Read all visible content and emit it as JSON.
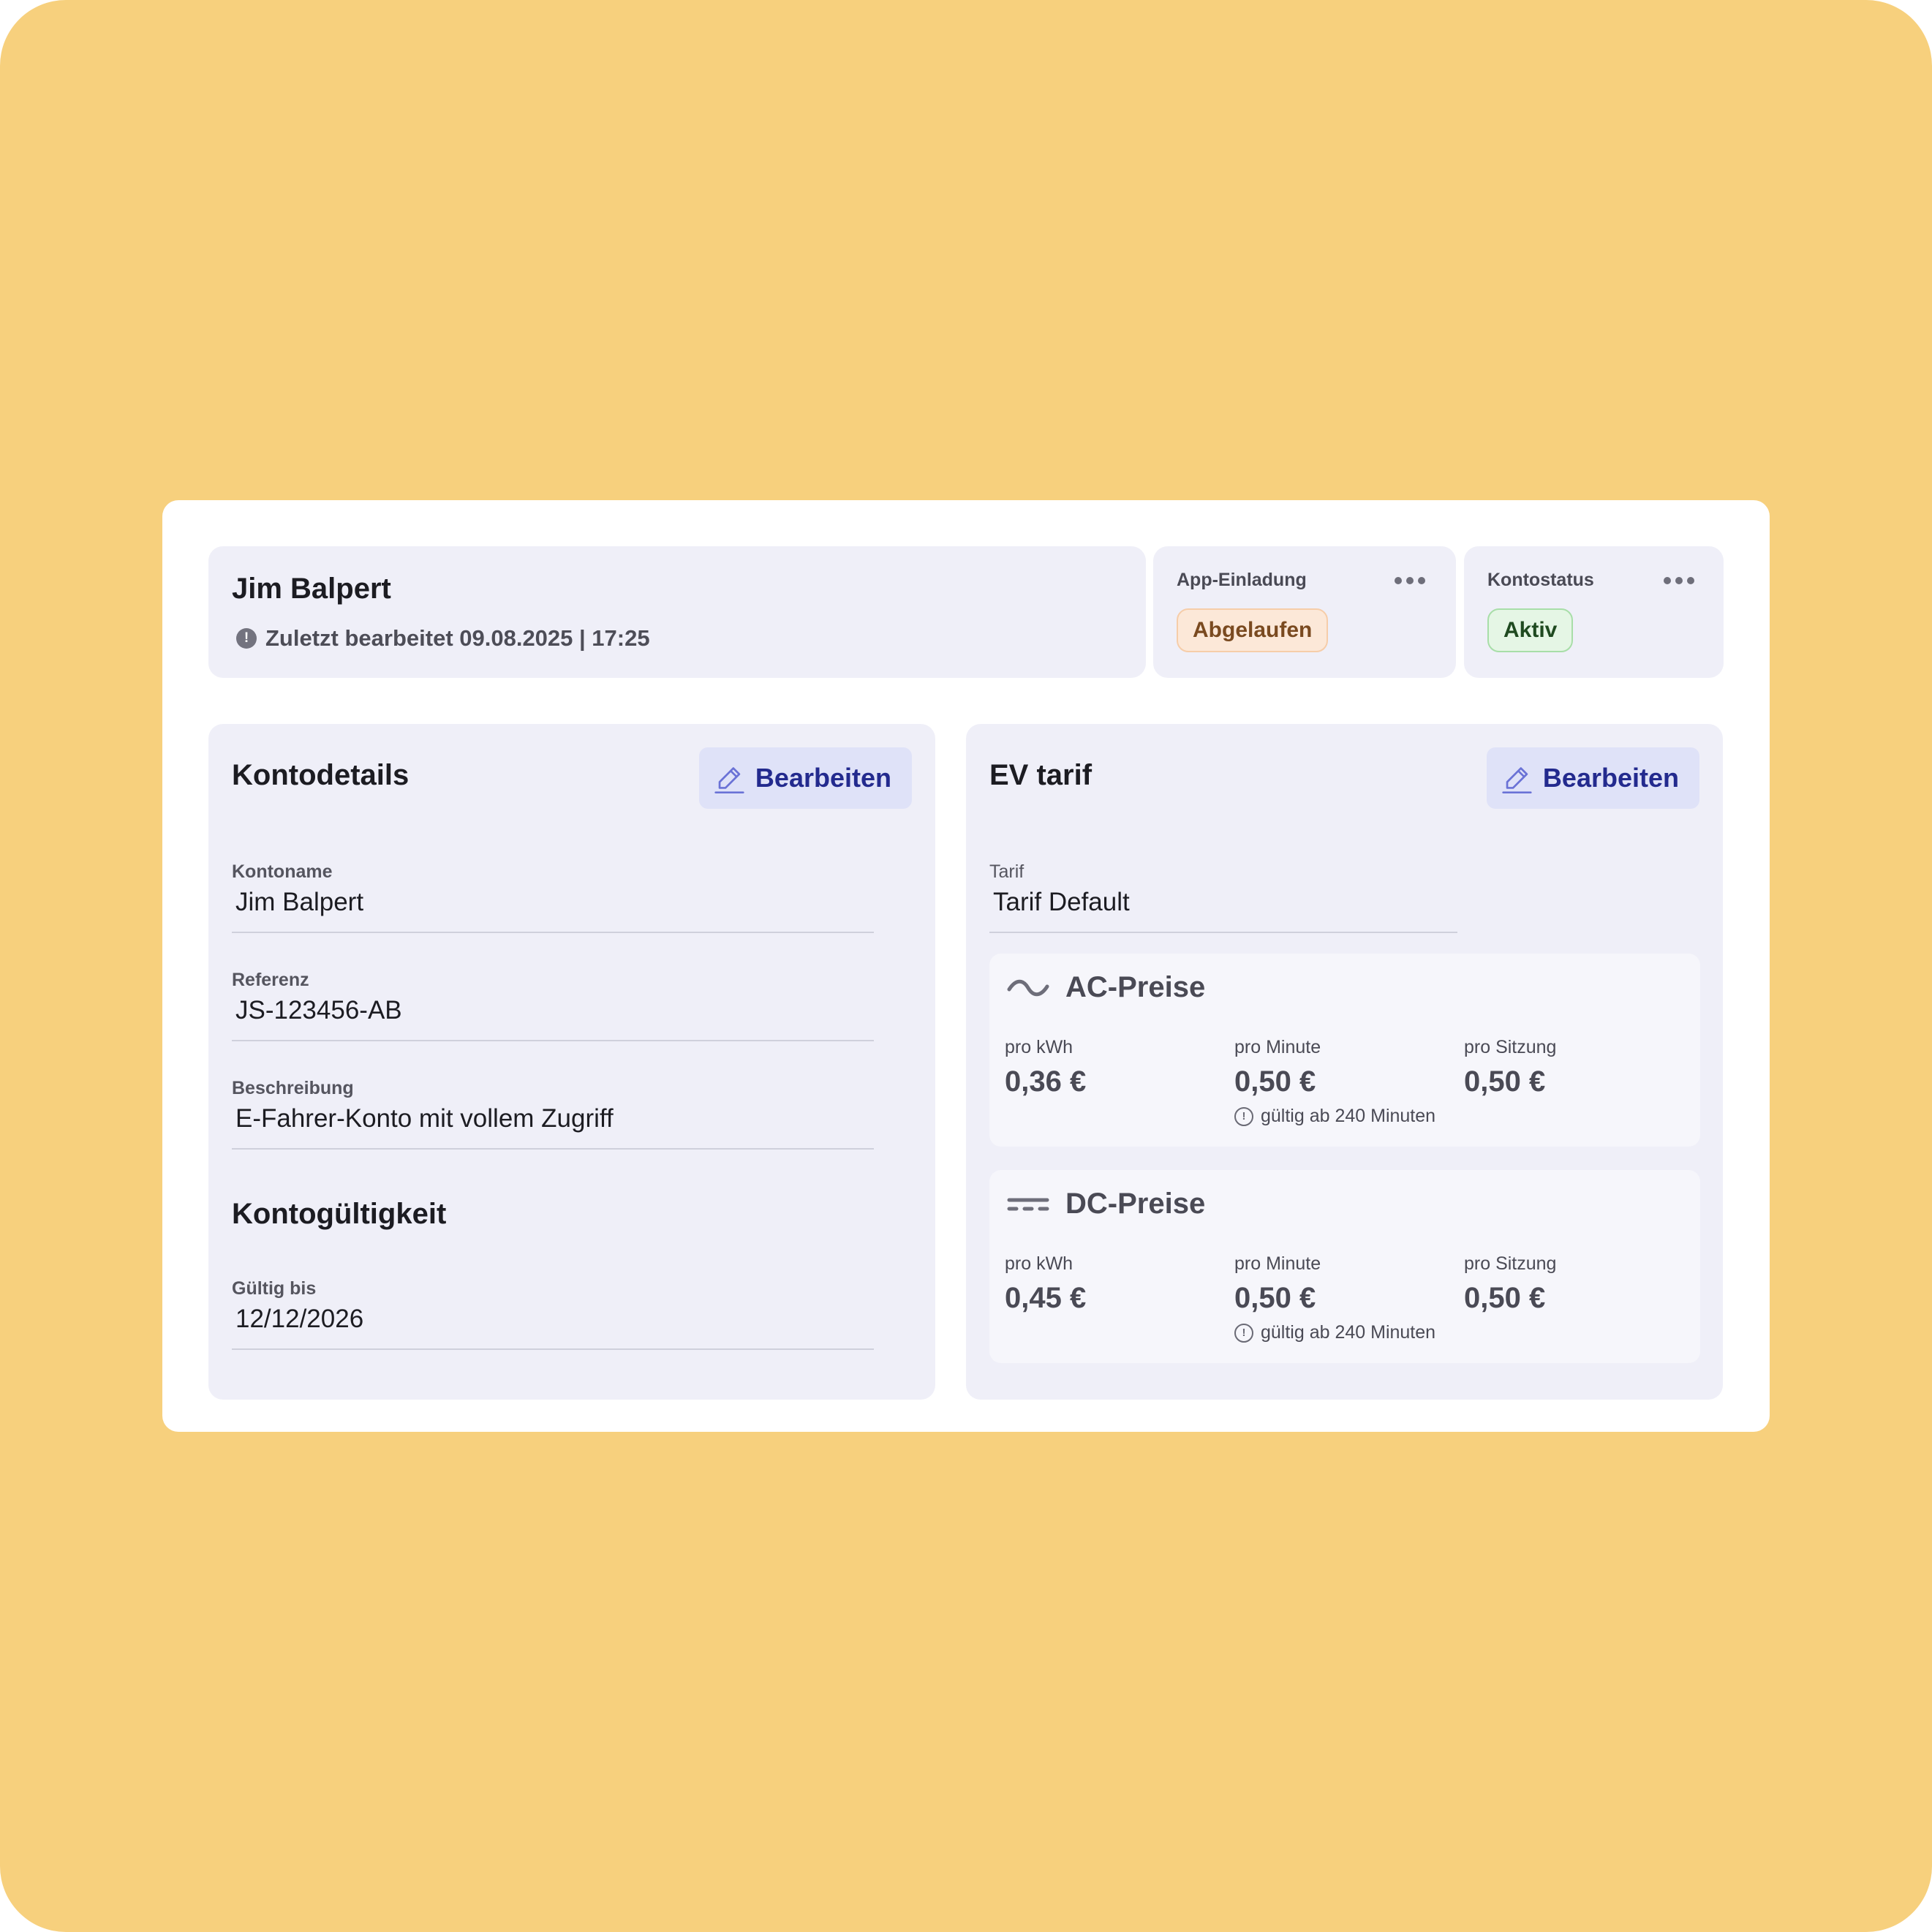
{
  "header": {
    "name": "Jim Balpert",
    "edited_icon": "info-icon",
    "last_edited": "Zuletzt bearbeitet 09.08.2025 | 17:25"
  },
  "app_invite": {
    "label": "App-Einladung",
    "badge": "Abgelaufen",
    "menu_icon": "more-horizontal-icon"
  },
  "account_status": {
    "label": "Kontostatus",
    "badge": "Aktiv",
    "menu_icon": "more-horizontal-icon"
  },
  "account_details": {
    "title": "Kontodetails",
    "edit_label": "Bearbeiten",
    "edit_icon": "pencil-icon",
    "fields": [
      {
        "label": "Kontoname",
        "value": "Jim Balpert"
      },
      {
        "label": "Referenz",
        "value": "JS-123456-AB"
      },
      {
        "label": "Beschreibung",
        "value": "E-Fahrer-Konto mit vollem Zugriff"
      }
    ],
    "validity_title": "Kontogültigkeit",
    "validity_field": {
      "label": "Gültig bis",
      "value": "12/12/2026"
    }
  },
  "ev_tariff": {
    "title": "EV tarif",
    "edit_label": "Bearbeiten",
    "edit_icon": "pencil-icon",
    "tariff_field": {
      "label": "Tarif",
      "value": "Tarif Default"
    },
    "ac": {
      "icon": "ac-wave-icon",
      "title": "AC-Preise",
      "per_kwh": {
        "label": "pro kWh",
        "value": "0,36 €"
      },
      "per_minute": {
        "label": "pro Minute",
        "value": "0,50 €",
        "note": "gültig ab 240 Minuten",
        "note_icon": "clock-icon"
      },
      "per_session": {
        "label": "pro Sitzung",
        "value": "0,50 €"
      }
    },
    "dc": {
      "icon": "dc-lines-icon",
      "title": "DC-Preise",
      "per_kwh": {
        "label": "pro kWh",
        "value": "0,45 €"
      },
      "per_minute": {
        "label": "pro Minute",
        "value": "0,50 €",
        "note": "gültig ab 240 Minuten",
        "note_icon": "clock-icon"
      },
      "per_session": {
        "label": "pro Sitzung",
        "value": "0,50 €"
      }
    }
  },
  "colors": {
    "background": "#f7d07d",
    "panel": "#efeff8",
    "accent": "#232a8e",
    "expired_badge": "#fce8d8",
    "active_badge": "#e5f6e5"
  }
}
